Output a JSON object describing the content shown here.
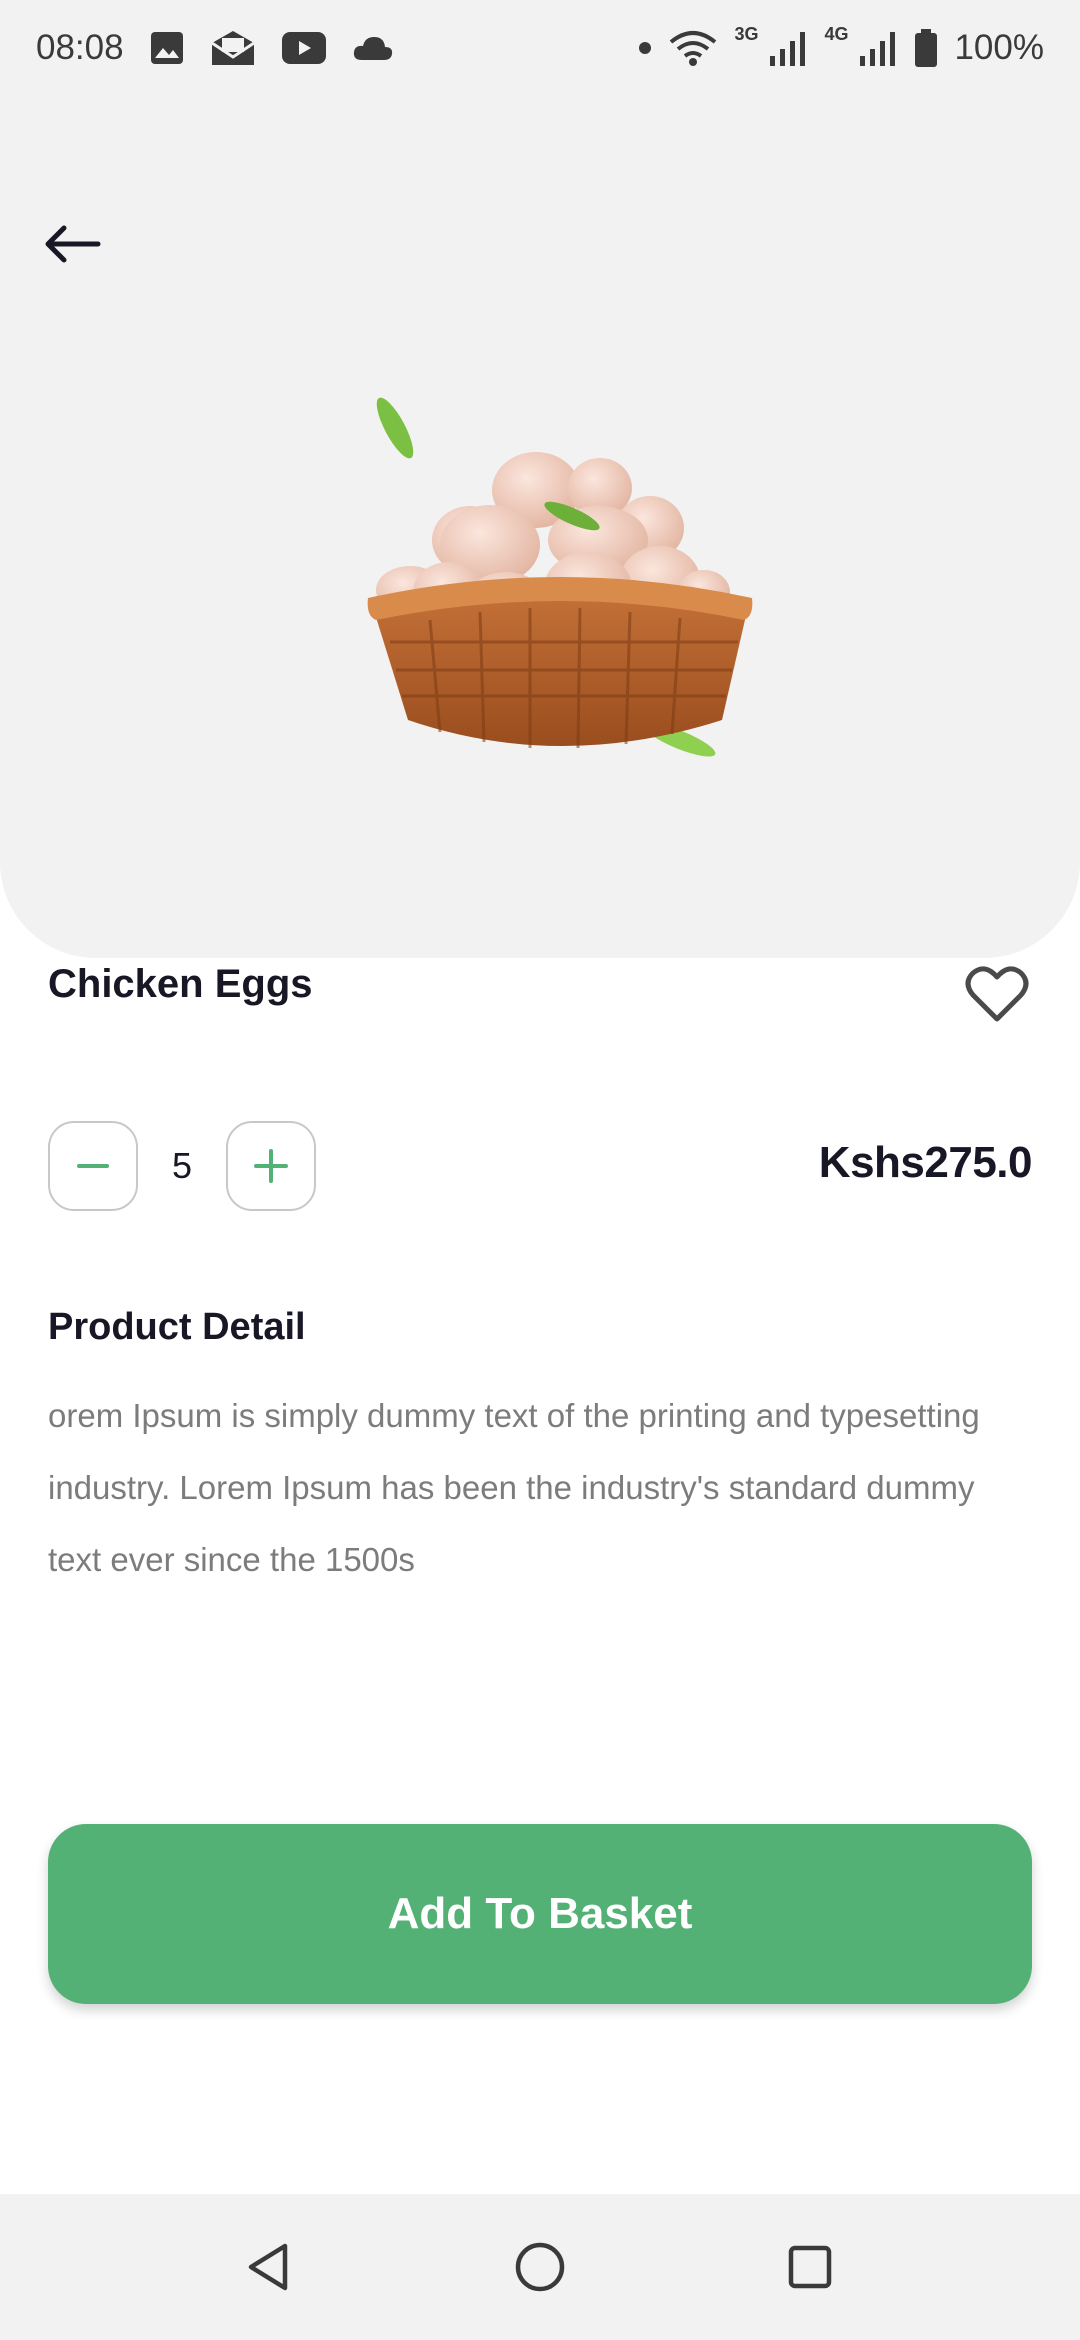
{
  "status_bar": {
    "time": "08:08",
    "notification_icons": [
      "image-icon",
      "mail-icon",
      "youtube-icon",
      "cloud-icon"
    ],
    "network_3g": "3G",
    "network_4g": "4G",
    "battery": "100%"
  },
  "product": {
    "name": "Chicken Eggs",
    "image": "egg-basket-image",
    "price": "Kshs275.0",
    "quantity": "5",
    "favorite": false
  },
  "detail": {
    "heading": "Product Detail",
    "description": "orem Ipsum is simply dummy text of the printing and typesetting industry. Lorem Ipsum has been the industry's standard dummy text ever since the 1500s"
  },
  "actions": {
    "add_to_basket": "Add To Basket"
  },
  "colors": {
    "accent": "#53B175",
    "hero_background": "#F2F2F2",
    "title_text": "#181725",
    "body_text": "#7C7C7C"
  }
}
